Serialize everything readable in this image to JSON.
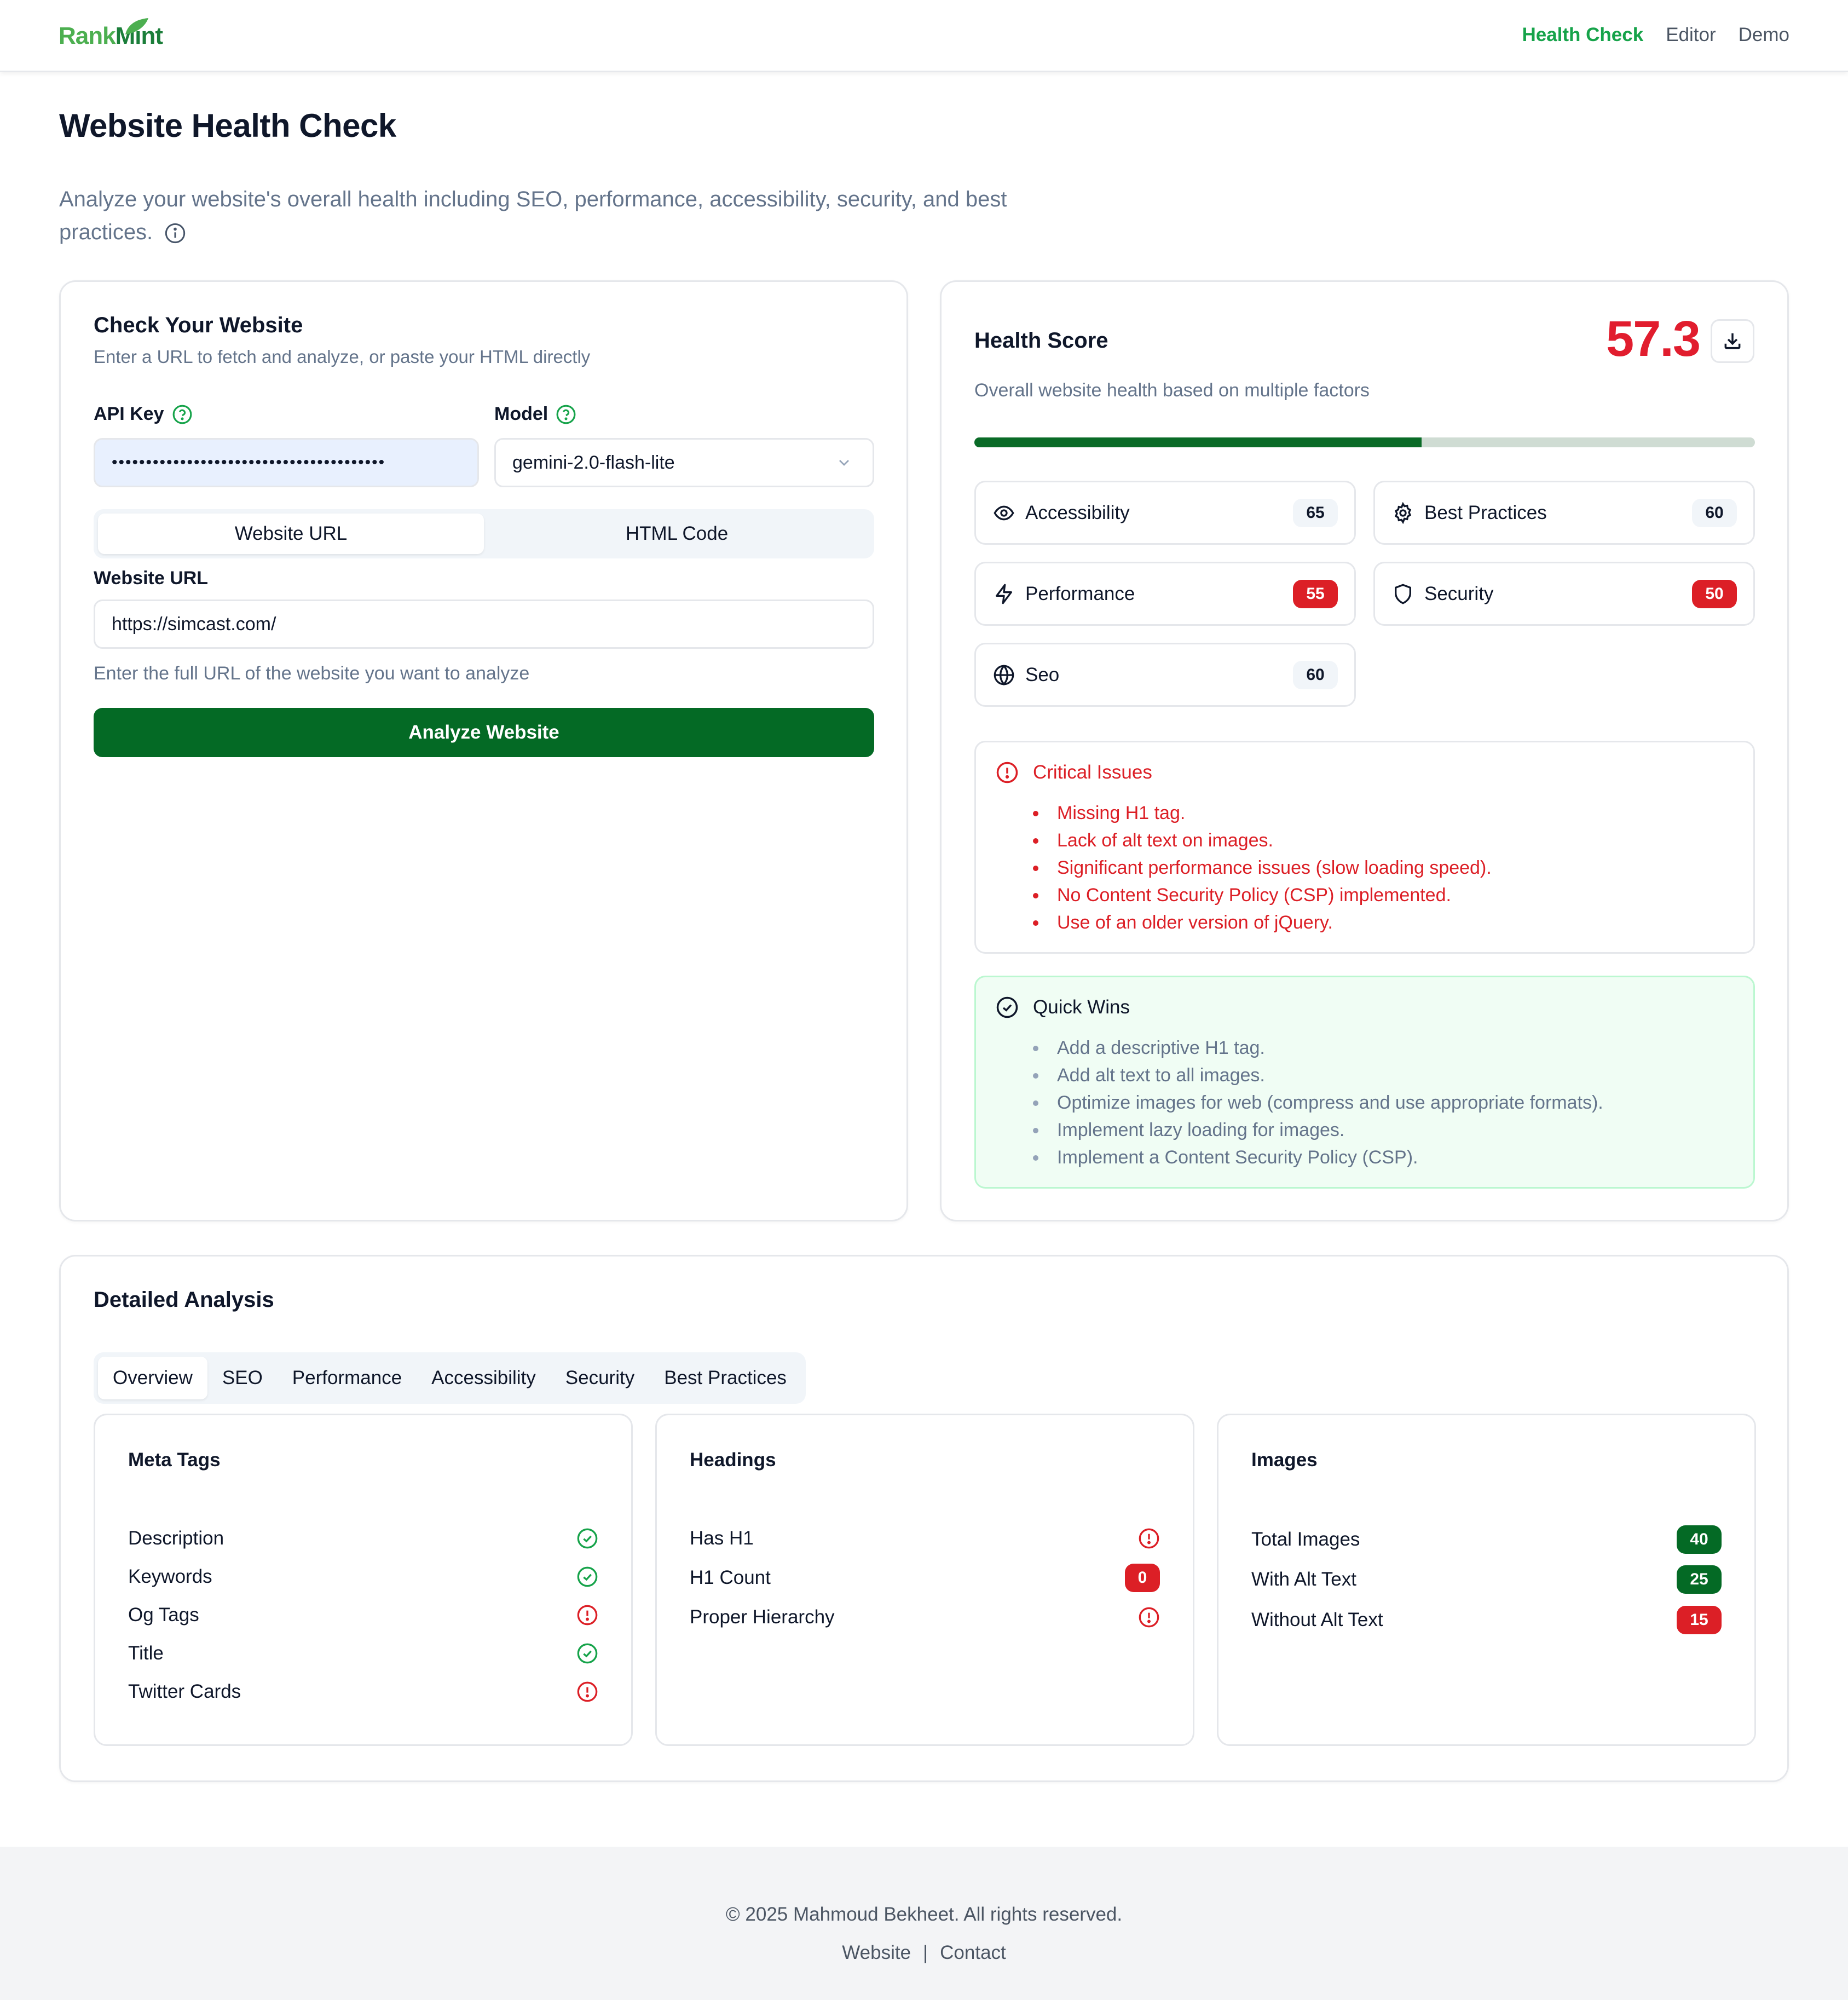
{
  "brand": {
    "part1": "Rank",
    "part2": "Mint"
  },
  "nav": {
    "items": [
      "Health Check",
      "Editor",
      "Demo"
    ],
    "active": "Health Check"
  },
  "page": {
    "title": "Website Health Check",
    "description": "Analyze your website's overall health including SEO, performance, accessibility, security, and best practices."
  },
  "check": {
    "title": "Check Your Website",
    "subtitle": "Enter a URL to fetch and analyze, or paste your HTML directly",
    "api_key_label": "API Key",
    "api_key_value": "••••••••••••••••••••••••••••••••••••••••",
    "model_label": "Model",
    "model_value": "gemini-2.0-flash-lite",
    "tab_url": "Website URL",
    "tab_html": "HTML Code",
    "url_label": "Website URL",
    "url_value": "https://simcast.com/",
    "url_help": "Enter the full URL of the website you want to analyze",
    "analyze_button": "Analyze Website"
  },
  "health": {
    "title": "Health Score",
    "subtitle": "Overall website health based on multiple factors",
    "score": "57.3",
    "score_fraction": 0.573,
    "metrics": [
      {
        "name": "Accessibility",
        "value": "65",
        "status": "gray",
        "icon": "eye-icon"
      },
      {
        "name": "Best Practices",
        "value": "60",
        "status": "gray",
        "icon": "gear-icon"
      },
      {
        "name": "Performance",
        "value": "55",
        "status": "red",
        "icon": "lightning-icon"
      },
      {
        "name": "Security",
        "value": "50",
        "status": "red",
        "icon": "shield-icon"
      },
      {
        "name": "Seo",
        "value": "60",
        "status": "gray",
        "icon": "globe-icon"
      }
    ],
    "critical_title": "Critical Issues",
    "critical": [
      "Missing H1 tag.",
      "Lack of alt text on images.",
      "Significant performance issues (slow loading speed).",
      "No Content Security Policy (CSP) implemented.",
      "Use of an older version of jQuery."
    ],
    "wins_title": "Quick Wins",
    "wins": [
      "Add a descriptive H1 tag.",
      "Add alt text to all images.",
      "Optimize images for web (compress and use appropriate formats).",
      "Implement lazy loading for images.",
      "Implement a Content Security Policy (CSP)."
    ]
  },
  "detail": {
    "title": "Detailed Analysis",
    "tabs": [
      "Overview",
      "SEO",
      "Performance",
      "Accessibility",
      "Security",
      "Best Practices"
    ],
    "active_tab": "Overview",
    "meta": {
      "title": "Meta Tags",
      "rows": [
        {
          "label": "Description",
          "ok": true
        },
        {
          "label": "Keywords",
          "ok": true
        },
        {
          "label": "Og Tags",
          "ok": false
        },
        {
          "label": "Title",
          "ok": true
        },
        {
          "label": "Twitter Cards",
          "ok": false
        }
      ]
    },
    "headings": {
      "title": "Headings",
      "has_h1": "Has H1",
      "h1_count_label": "H1 Count",
      "h1_count": "0",
      "hierarchy": "Proper Hierarchy"
    },
    "images": {
      "title": "Images",
      "total_label": "Total Images",
      "total": "40",
      "with_alt_label": "With Alt Text",
      "with_alt": "25",
      "without_alt_label": "Without Alt Text",
      "without_alt": "15"
    }
  },
  "footer": {
    "copyright": "© 2025 Mahmoud Bekheet. All rights reserved.",
    "link_website": "Website",
    "separator": "|",
    "link_contact": "Contact"
  },
  "colors": {
    "brand_green": "#046a25",
    "accent_green": "#16a34a",
    "danger_red": "#dc1f26"
  }
}
